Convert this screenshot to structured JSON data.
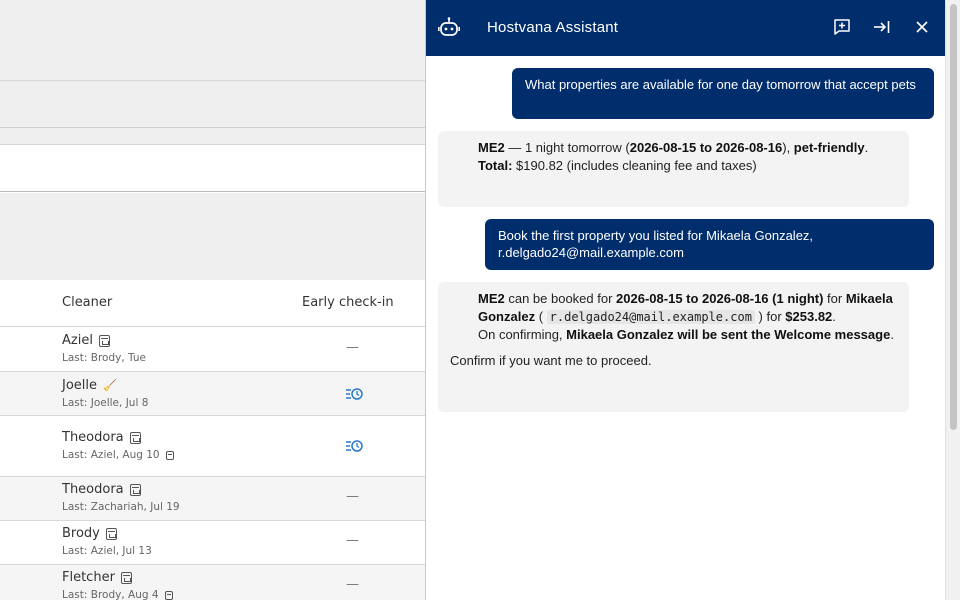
{
  "table": {
    "headers": {
      "cleaner": "Cleaner",
      "early_checkin": "Early check-in"
    },
    "rows": [
      {
        "name": "Aziel",
        "last": "Last: Brody, Tue",
        "early": "—",
        "early_icon": "none"
      },
      {
        "name": "Joelle",
        "last": "Last: Joelle, Jul 8",
        "early": "",
        "early_icon": "schedule-icon"
      },
      {
        "name": "Theodora",
        "last": "Last: Aziel, Aug 10",
        "early": "",
        "early_icon": "schedule-icon"
      },
      {
        "name": "Theodora",
        "last": "Last: Zachariah, Jul 19",
        "early": "—",
        "early_icon": "none"
      },
      {
        "name": "Brody",
        "last": "Last: Aziel, Jul 13",
        "early": "—",
        "early_icon": "none"
      },
      {
        "name": "Fletcher",
        "last": "Last: Brody, Aug 4",
        "early": "—",
        "early_icon": "none"
      }
    ]
  },
  "assistant": {
    "title": "Hostvana Assistant",
    "icons": [
      "robot-icon",
      "new-chat-icon",
      "collapse-panel-icon",
      "close-icon"
    ],
    "messages": {
      "user_1": "What properties are available for one day tomorrow that accept pets",
      "bot_1": {
        "property": "ME2",
        "sep": " — 1 night tomorrow (",
        "dates": "2026-08-15 to 2026-08-16",
        "close_paren": "), ",
        "pet": "pet-friendly",
        "period": ".",
        "total_label": "Total:",
        "total_text": " $190.82 (includes cleaning fee and taxes)"
      },
      "user_2": "Book the first property you listed for Mikaela Gonzalez, r.delgado24@mail.example.com",
      "bot_2": {
        "property": "ME2",
        "t1": " can be booked for ",
        "dates": "2026-08-15 to 2026-08-16 (1 night)",
        "t2": " for ",
        "guest": "Mikaela Gonzalez",
        "t3": " ( ",
        "email": "r.delgado24@mail.example.com",
        "t4": " ) for ",
        "price": "$253.82",
        "t5": ".",
        "t6": "On confirming, ",
        "welcome": "Mikaela Gonzalez will be sent the Welcome message",
        "t7": ".",
        "confirm": "Confirm if you want me to proceed."
      }
    }
  },
  "colors": {
    "header": "#002d6b",
    "user_bubble": "#002d6b",
    "bot_bubble": "#f3f3f3",
    "accent_icon": "#2a79c7"
  }
}
